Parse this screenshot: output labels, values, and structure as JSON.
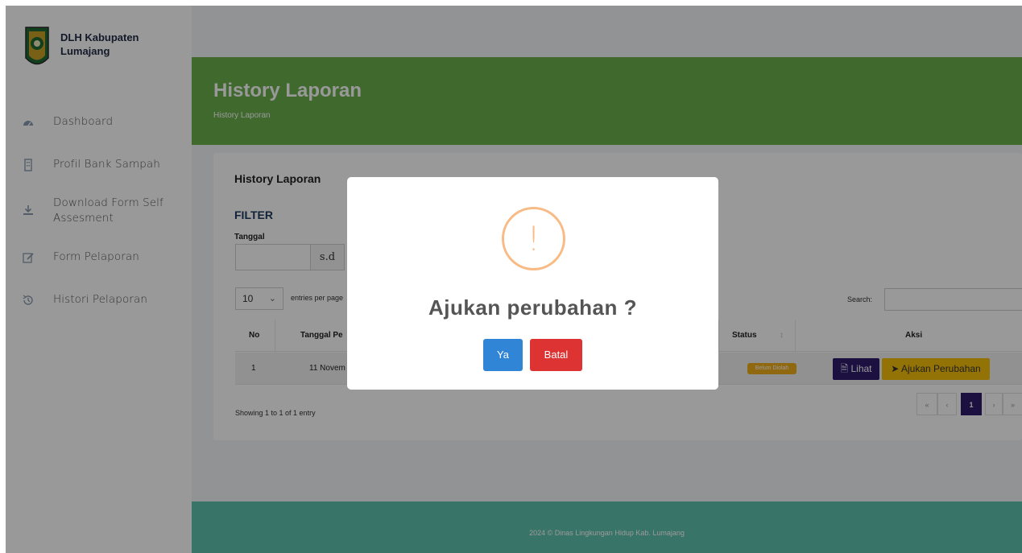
{
  "brand": {
    "name": "DLH Kabupaten Lumajang"
  },
  "sidebar": {
    "items": [
      {
        "label": "Dashboard",
        "icon": "dashboard-icon"
      },
      {
        "label": "Profil Bank Sampah",
        "icon": "building-icon"
      },
      {
        "label": "Download Form Self Assesment",
        "icon": "download-icon"
      },
      {
        "label": "Form Pelaporan",
        "icon": "edit-icon"
      },
      {
        "label": "Histori Pelaporan",
        "icon": "history-icon"
      }
    ]
  },
  "header": {
    "title": "History Laporan",
    "breadcrumb": "History Laporan",
    "color": "#6ab04c"
  },
  "card": {
    "title": "History Laporan",
    "filter_title": "FILTER",
    "date_label": "Tanggal",
    "date_from_value": "",
    "date_separator": "s.d",
    "entries_value": "10",
    "entries_label": "entries per page",
    "search_label": "Search:",
    "search_value": ""
  },
  "table": {
    "columns": [
      "No",
      "Tanggal Pe",
      "Status",
      "Aksi"
    ],
    "rows": [
      {
        "no": "1",
        "tanggal": "11 Novem",
        "status": "Belum Diolah",
        "actions": [
          "Lihat",
          "Ajukan Perubahan"
        ]
      }
    ]
  },
  "pagination": {
    "showing": "Showing 1 to 1 of 1 entry",
    "items": [
      "«",
      "‹",
      "1",
      "›",
      "»"
    ],
    "active": "1"
  },
  "footer": {
    "text": "2024 © Dinas Lingkungan Hidup Kab. Lumajang",
    "color": "#5fc2ad"
  },
  "modal": {
    "icon": "warning-icon",
    "icon_glyph": "!",
    "title": "Ajukan perubahan ?",
    "confirm_label": "Ya",
    "cancel_label": "Batal",
    "confirm_color": "#3085d6",
    "cancel_color": "#dd3333"
  }
}
